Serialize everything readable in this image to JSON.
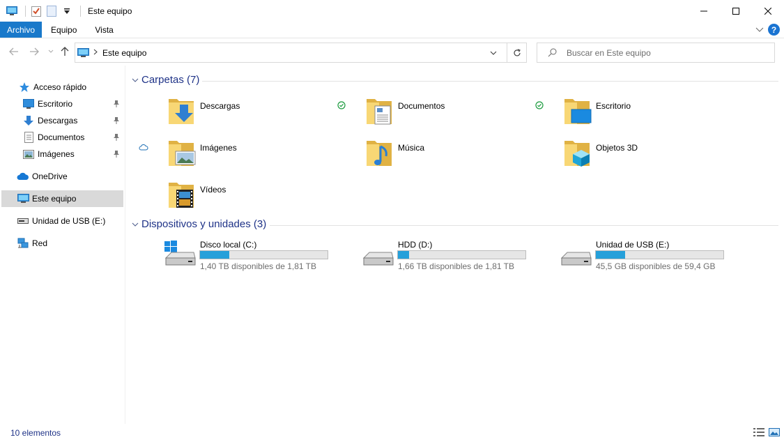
{
  "window": {
    "title": "Este equipo"
  },
  "ribbon": {
    "tabs": [
      {
        "label": "Archivo"
      },
      {
        "label": "Equipo"
      },
      {
        "label": "Vista"
      }
    ],
    "help_label": "?"
  },
  "nav": {
    "address_path": "Este equipo",
    "search_placeholder": "Buscar en Este equipo"
  },
  "sidebar": {
    "items": [
      {
        "label": "Acceso rápido",
        "icon": "star-icon"
      },
      {
        "label": "Escritorio",
        "icon": "desktop-icon",
        "pinned": true
      },
      {
        "label": "Descargas",
        "icon": "download-arrow-icon",
        "pinned": true
      },
      {
        "label": "Documentos",
        "icon": "document-icon",
        "pinned": true
      },
      {
        "label": "Imágenes",
        "icon": "pictures-icon",
        "pinned": true
      },
      {
        "label": "OneDrive",
        "icon": "cloud-icon"
      },
      {
        "label": "Este equipo",
        "icon": "computer-icon",
        "selected": true
      },
      {
        "label": "Unidad de USB (E:)",
        "icon": "usb-drive-icon"
      },
      {
        "label": "Red",
        "icon": "network-icon"
      }
    ]
  },
  "groups": {
    "folders": {
      "title": "Carpetas (7)",
      "items": [
        {
          "name": "Descargas",
          "overlay": "download-arrow-icon",
          "status": "none"
        },
        {
          "name": "Documentos",
          "overlay": "document-icon",
          "status": "synced"
        },
        {
          "name": "Escritorio",
          "overlay": "desktop-icon",
          "status": "synced"
        },
        {
          "name": "Imágenes",
          "overlay": "pictures-icon",
          "status": "cloud"
        },
        {
          "name": "Música",
          "overlay": "music-note-icon",
          "status": "none"
        },
        {
          "name": "Objetos 3D",
          "overlay": "cube-icon",
          "status": "none"
        },
        {
          "name": "Vídeos",
          "overlay": "film-icon",
          "status": "none"
        }
      ]
    },
    "devices": {
      "title": "Dispositivos y unidades (3)",
      "items": [
        {
          "name": "Disco local (C:)",
          "free": "1,40 TB disponibles de 1,81 TB",
          "used_fraction": 0.23,
          "windows_logo": true
        },
        {
          "name": "HDD (D:)",
          "free": "1,66 TB disponibles de 1,81 TB",
          "used_fraction": 0.09,
          "windows_logo": false
        },
        {
          "name": "Unidad de USB (E:)",
          "free": "45,5 GB disponibles de 59,4 GB",
          "used_fraction": 0.23,
          "windows_logo": false
        }
      ]
    }
  },
  "statusbar": {
    "count": "10 elementos"
  },
  "colors": {
    "accent": "#1979ca",
    "group_header": "#1e3287",
    "drive_fill": "#26a0da",
    "folder": "#f8d775",
    "sync_green": "#1c9b3f",
    "selected_bg": "#d9d9d9"
  }
}
